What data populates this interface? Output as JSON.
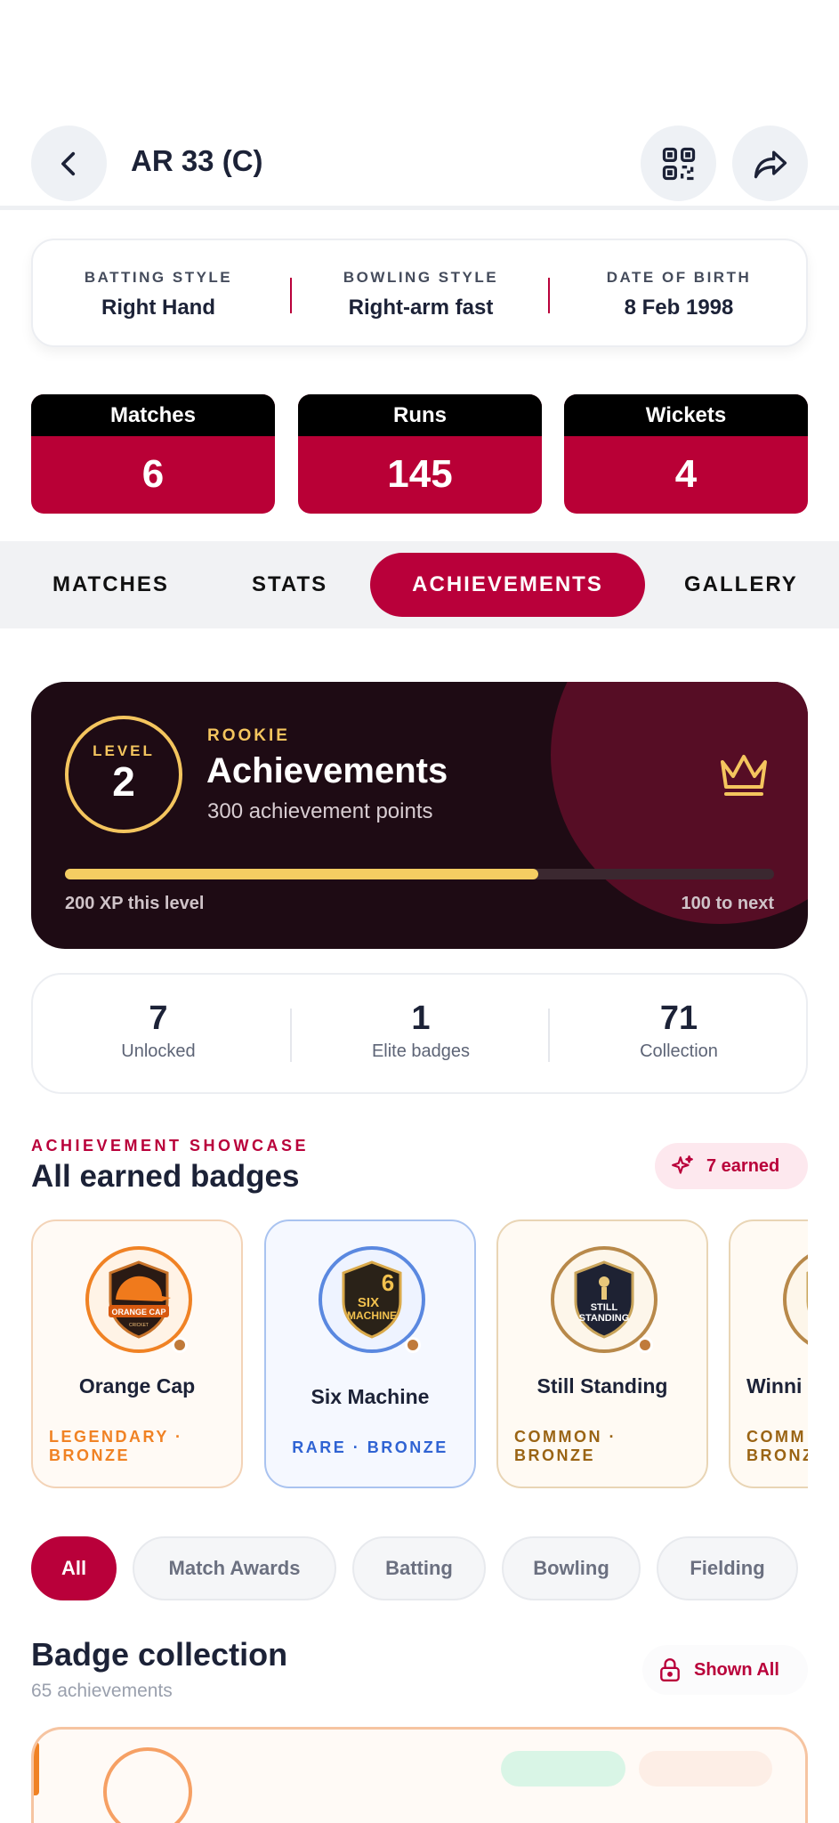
{
  "header": {
    "title": "AR 33 (C)"
  },
  "info": [
    {
      "label": "BATTING STYLE",
      "value": "Right Hand"
    },
    {
      "label": "BOWLING STYLE",
      "value": "Right-arm fast"
    },
    {
      "label": "DATE OF BIRTH",
      "value": "8 Feb 1998"
    }
  ],
  "stats": [
    {
      "label": "Matches",
      "value": "6"
    },
    {
      "label": "Runs",
      "value": "145"
    },
    {
      "label": "Wickets",
      "value": "4"
    }
  ],
  "tabs": [
    "MATCHES",
    "STATS",
    "ACHIEVEMENTS",
    "GALLERY"
  ],
  "active_tab": "ACHIEVEMENTS",
  "hero": {
    "level_label": "LEVEL",
    "level": "2",
    "tier": "ROOKIE",
    "title": "Achievements",
    "subtitle": "300 achievement points",
    "xp_left": "200 XP this level",
    "xp_right": "100 to next",
    "progress_fraction": 0.667,
    "icon": "crown-icon"
  },
  "summary": [
    {
      "value": "7",
      "label": "Unlocked"
    },
    {
      "value": "1",
      "label": "Elite badges"
    },
    {
      "value": "71",
      "label": "Collection"
    }
  ],
  "showcase": {
    "kicker": "ACHIEVEMENT SHOWCASE",
    "title": "All earned badges",
    "earned_pill": "7 earned",
    "badges": [
      {
        "name": "Orange Cap",
        "rarity1": "LEGENDARY ·",
        "rarity2": "BRONZE",
        "emblem1": "ORANGE CAP",
        "emblem2": "CRICKET"
      },
      {
        "name": "Six Machine",
        "rarity1": "RARE · BRONZE",
        "rarity2": "",
        "emblem1": "SIX",
        "emblem2": "MACHINE",
        "emblem3": "6"
      },
      {
        "name": "Still Standing",
        "rarity1": "COMMON ·",
        "rarity2": "BRONZE",
        "emblem1": "STILL",
        "emblem2": "STANDING"
      },
      {
        "name": "Winni",
        "rarity1": "COMM",
        "rarity2": "BRONZ"
      }
    ]
  },
  "filters": [
    "All",
    "Match Awards",
    "Batting",
    "Bowling",
    "Fielding"
  ],
  "collection": {
    "title": "Badge collection",
    "subtitle": "65 achievements",
    "shown_label": "Shown All"
  },
  "colors": {
    "accent": "#b9003a",
    "gold": "#f4c55e",
    "hero_bg": "#1e0b14",
    "orange": "#f08224",
    "blue": "#2f63d3",
    "brown": "#9a6414"
  }
}
